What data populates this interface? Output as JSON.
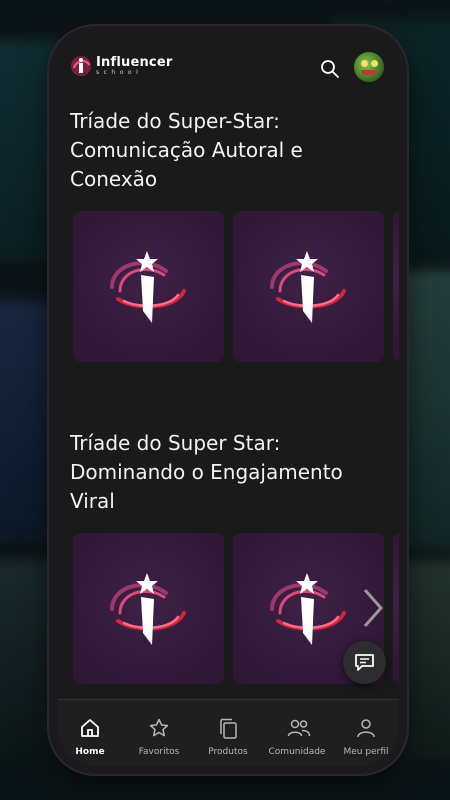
{
  "app": {
    "logo_title": "Influencer",
    "logo_subtitle": "school"
  },
  "header": {
    "search_icon": "search-icon",
    "avatar_icon": "profile-avatar"
  },
  "sections": [
    {
      "title": "Tríade do Super-Star: Comunicação Autoral e Conexão"
    },
    {
      "title": "Tríade do Super Star: Dominando o Engajamento Viral"
    }
  ],
  "bottom_nav": {
    "items": [
      {
        "label": "Home",
        "icon": "home-icon",
        "active": true
      },
      {
        "label": "Favoritos",
        "icon": "star-icon",
        "active": false
      },
      {
        "label": "Produtos",
        "icon": "copy-icon",
        "active": false
      },
      {
        "label": "Comunidade",
        "icon": "people-icon",
        "active": false
      },
      {
        "label": "Meu perfil",
        "icon": "user-icon",
        "active": false
      }
    ]
  },
  "colors": {
    "accent_pink": "#e0487a",
    "accent_red": "#d0283a",
    "card_bg": "#33193a"
  }
}
